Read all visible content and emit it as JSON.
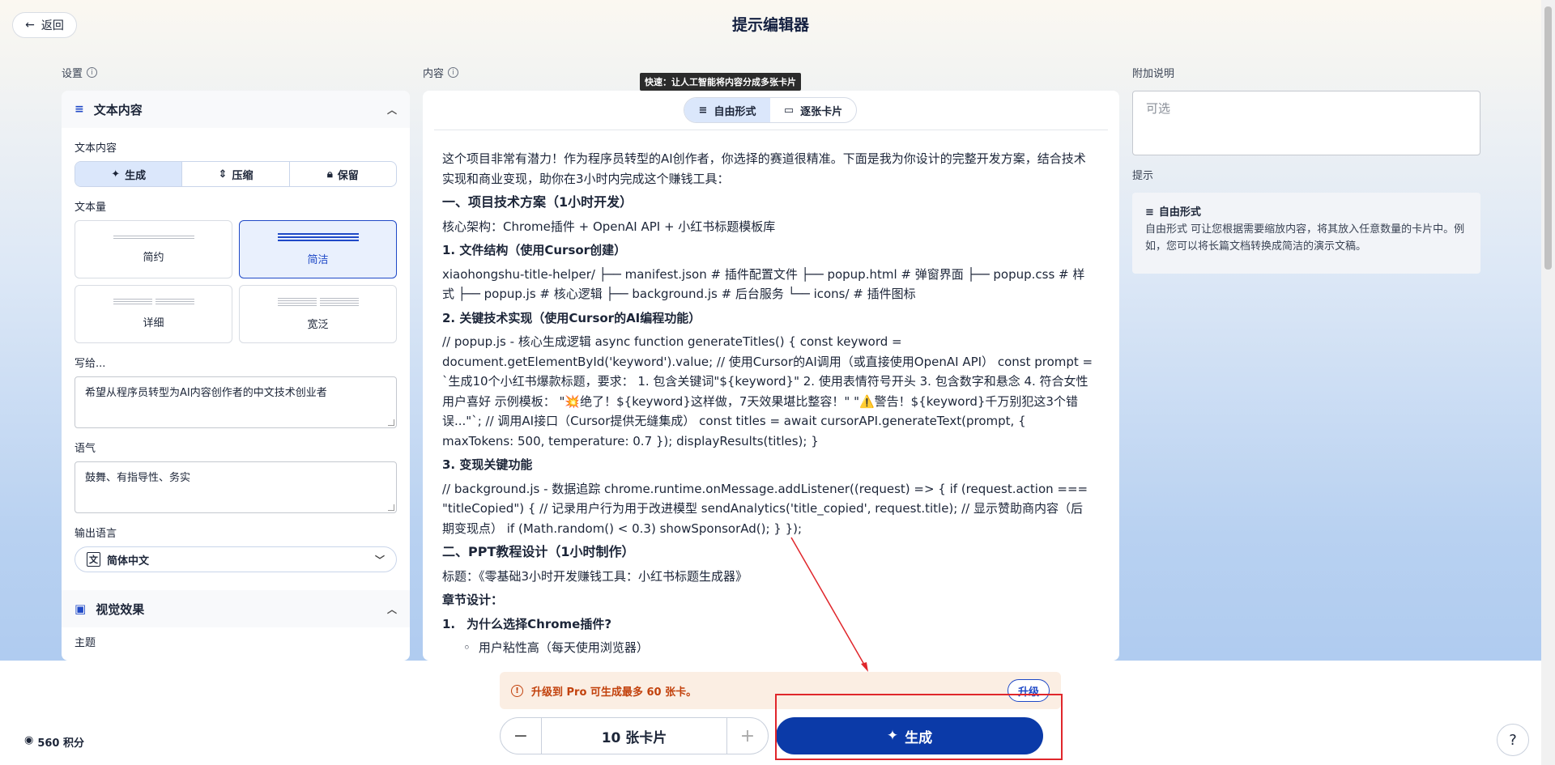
{
  "header": {
    "back_label": "返回",
    "title": "提示编辑器"
  },
  "settings": {
    "label": "设置",
    "text_section": {
      "title": "文本内容",
      "text_content_label": "文本内容",
      "modes": [
        "生成",
        "压缩",
        "保留"
      ],
      "amount_label": "文本量",
      "amounts": [
        "简约",
        "简洁",
        "详细",
        "宽泛"
      ],
      "selected_amount": "简洁",
      "write_for_label": "写给...",
      "write_for_value": "希望从程序员转型为AI内容创作者的中文技术创业者",
      "tone_label": "语气",
      "tone_value": "鼓舞、有指导性、务实",
      "output_lang_label": "输出语言",
      "output_lang_value": "简体中文"
    },
    "visual_section": {
      "title": "视觉效果",
      "cut_label": "主题"
    }
  },
  "content": {
    "label": "内容",
    "tooltip": "快速：让人工智能将内容分成多张卡片",
    "modes": [
      "自由形式",
      "逐张卡片"
    ],
    "blocks": [
      {
        "type": "p",
        "text": "这个项目非常有潜力！作为程序员转型的AI创作者，你选择的赛道很精准。下面是我为你设计的完整开发方案，结合技术实现和商业变现，助你在3小时内完成这个赚钱工具："
      },
      {
        "type": "h1",
        "text": "一、项目技术方案（1小时开发）"
      },
      {
        "type": "p",
        "text": "核心架构：Chrome插件 + OpenAI API + 小红书标题模板库"
      },
      {
        "type": "h2",
        "text": "1. 文件结构（使用Cursor创建）"
      },
      {
        "type": "p",
        "text": "xiaohongshu-title-helper/ ├── manifest.json # 插件配置文件 ├── popup.html # 弹窗界面 ├── popup.css # 样式 ├── popup.js # 核心逻辑 ├── background.js # 后台服务 └── icons/ # 插件图标"
      },
      {
        "type": "h2",
        "text": "2. 关键技术实现（使用Cursor的AI编程功能）"
      },
      {
        "type": "p",
        "text": "// popup.js - 核心生成逻辑 async function generateTitles() { const keyword = document.getElementById('keyword').value; // 使用Cursor的AI调用（或直接使用OpenAI API） const prompt = `生成10个小红书爆款标题，要求： 1. 包含关键词\"${keyword}\" 2. 使用表情符号开头 3. 包含数字和悬念 4. 符合女性用户喜好 示例模板： \"💥绝了！${keyword}这样做，7天效果堪比整容！\" \"⚠️警告！${keyword}千万别犯这3个错误...\"`; // 调用AI接口（Cursor提供无缝集成） const titles = await cursorAPI.generateText(prompt, { maxTokens: 500, temperature: 0.7 }); displayResults(titles); }"
      },
      {
        "type": "h2",
        "text": "3. 变现关键功能"
      },
      {
        "type": "p",
        "text": "// background.js - 数据追踪 chrome.runtime.onMessage.addListener((request) => { if (request.action === \"titleCopied\") { // 记录用户行为用于改进模型 sendAnalytics('title_copied', request.title); // 显示赞助商内容（后期变现点） if (Math.random() < 0.3) showSponsorAd(); } });"
      },
      {
        "type": "h1",
        "text": "二、PPT教程设计（1小时制作）"
      },
      {
        "type": "p",
        "text": "标题：《零基础3小时开发赚钱工具：小红书标题生成器》"
      },
      {
        "type": "h2",
        "text": "章节设计："
      },
      {
        "type": "num",
        "n": "1.",
        "text": "为什么选择Chrome插件?"
      },
      {
        "type": "bul",
        "text": "用户粘性高（每天使用浏览器）"
      }
    ]
  },
  "extra": {
    "label": "附加说明",
    "placeholder": "可选",
    "hint_label": "提示",
    "hint_title": "自由形式",
    "hint_text": "自由形式 可让您根据需要缩放内容，将其放入任意数量的卡片中。例如，您可以将长篇文档转换成简洁的演示文稿。"
  },
  "bottom": {
    "credits": "560 积分",
    "upgrade_text": "升级到 Pro 可生成最多 60 张卡。",
    "upgrade_button": "升级",
    "card_count": "10 张卡片",
    "generate_label": "生成",
    "help": "?"
  },
  "colors": {
    "accent": "#0b3aa8",
    "warning": "#c2410c",
    "annotation": "#e0262b"
  }
}
